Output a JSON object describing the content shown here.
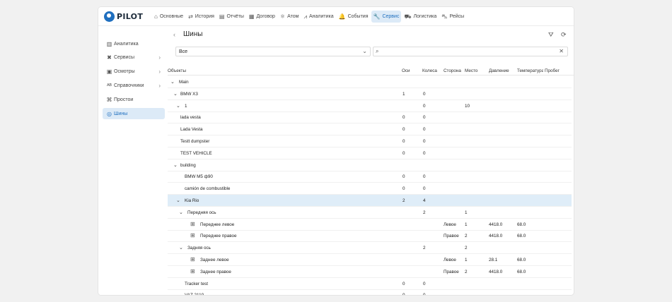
{
  "app": {
    "logo": "PILOT"
  },
  "nav": [
    {
      "icon": "home-icon",
      "glyph": "⌂",
      "label": "Основные"
    },
    {
      "icon": "arrows-icon",
      "glyph": "⇄",
      "label": "История"
    },
    {
      "icon": "report-icon",
      "glyph": "▤",
      "label": "Отчёты"
    },
    {
      "icon": "contract-icon",
      "glyph": "▦",
      "label": "Договор"
    },
    {
      "icon": "atom-icon",
      "glyph": "⚛",
      "label": "Атом"
    },
    {
      "icon": "analytics-icon",
      "glyph": "⩘",
      "label": "Аналитика"
    },
    {
      "icon": "bell-icon",
      "glyph": "🔔",
      "label": "События"
    },
    {
      "icon": "wrench-icon",
      "glyph": "🔧",
      "label": "Сервис"
    },
    {
      "icon": "truck-icon",
      "glyph": "⛟",
      "label": "Логистика"
    },
    {
      "icon": "bus-icon",
      "glyph": "⛍",
      "label": "Рейсы"
    }
  ],
  "nav_active": "Сервис",
  "sidebar": [
    {
      "icon": "bar-chart-icon",
      "glyph": "▥",
      "label": "Аналитика",
      "chevron": false
    },
    {
      "icon": "tools-icon",
      "glyph": "✖",
      "label": "Сервисы",
      "chevron": true
    },
    {
      "icon": "inspection-icon",
      "glyph": "▣",
      "label": "Осмотры",
      "chevron": true
    },
    {
      "icon": "abc-icon",
      "glyph": "ᴬᴮ",
      "label": "Справочники",
      "chevron": true
    },
    {
      "icon": "downtime-icon",
      "glyph": "⌘",
      "label": "Простои",
      "chevron": false
    },
    {
      "icon": "tire-icon",
      "glyph": "◎",
      "label": "Шины",
      "chevron": false
    }
  ],
  "sidebar_chevron": "›",
  "page": {
    "title": "Шины",
    "back": "‹"
  },
  "filter": {
    "value": "Все",
    "chevron": "⌄"
  },
  "search": {
    "placeholder": "",
    "clear": "✕",
    "icon_glyph": "⌕"
  },
  "header_icons": {
    "filter_glyph": "⛛",
    "refresh_glyph": "⟳"
  },
  "columns": {
    "objects": "Объекты",
    "axes": "Оси",
    "wheels": "Колеса",
    "side": "Сторона",
    "place": "Место",
    "pressure": "Давление",
    "temperature": "Температура",
    "mileage": "Пробег"
  },
  "glyphs": {
    "expand": "⌄",
    "tire": "⊞"
  },
  "rows": [
    {
      "level": 0,
      "toggle": true,
      "name": "Main",
      "axes": "",
      "wheels": "",
      "side": "",
      "place": "",
      "pressure": "",
      "temp": "",
      "selected": false,
      "tire": false
    },
    {
      "level": 1,
      "toggle": true,
      "name": "BMW X3",
      "axes": "1",
      "wheels": "0",
      "side": "",
      "place": "",
      "pressure": "",
      "temp": "",
      "selected": false,
      "tire": false
    },
    {
      "level": 2,
      "toggle": true,
      "name": "1",
      "axes": "",
      "wheels": "0",
      "side": "",
      "place": "10",
      "pressure": "",
      "temp": "",
      "selected": false,
      "tire": false
    },
    {
      "level": 1,
      "toggle": false,
      "name": "lada vesta",
      "axes": "0",
      "wheels": "0",
      "side": "",
      "place": "",
      "pressure": "",
      "temp": "",
      "selected": false,
      "tire": false
    },
    {
      "level": 1,
      "toggle": false,
      "name": "Lada Vesta",
      "axes": "0",
      "wheels": "0",
      "side": "",
      "place": "",
      "pressure": "",
      "temp": "",
      "selected": false,
      "tire": false
    },
    {
      "level": 1,
      "toggle": false,
      "name": "Testt dumpster",
      "axes": "0",
      "wheels": "0",
      "side": "",
      "place": "",
      "pressure": "",
      "temp": "",
      "selected": false,
      "tire": false
    },
    {
      "level": 1,
      "toggle": false,
      "name": "TEST VEHICLE",
      "axes": "0",
      "wheels": "0",
      "side": "",
      "place": "",
      "pressure": "",
      "temp": "",
      "selected": false,
      "tire": false
    },
    {
      "level": 1,
      "toggle": true,
      "name": "building",
      "axes": "",
      "wheels": "",
      "side": "",
      "place": "",
      "pressure": "",
      "temp": "",
      "selected": false,
      "tire": false
    },
    {
      "level": 2,
      "toggle": false,
      "name": "BMW M5 ф90",
      "axes": "0",
      "wheels": "0",
      "side": "",
      "place": "",
      "pressure": "",
      "temp": "",
      "selected": false,
      "tire": false
    },
    {
      "level": 2,
      "toggle": false,
      "name": "camión de combustible",
      "axes": "0",
      "wheels": "0",
      "side": "",
      "place": "",
      "pressure": "",
      "temp": "",
      "selected": false,
      "tire": false
    },
    {
      "level": 2,
      "toggle": true,
      "name": "Kia Rio",
      "axes": "2",
      "wheels": "4",
      "side": "",
      "place": "",
      "pressure": "",
      "temp": "",
      "selected": true,
      "tire": false
    },
    {
      "level": 3,
      "toggle": true,
      "name": "Передняя ось",
      "axes": "",
      "wheels": "2",
      "side": "",
      "place": "1",
      "pressure": "",
      "temp": "",
      "selected": false,
      "tire": false
    },
    {
      "level": 4,
      "toggle": false,
      "name": "Переднее левое",
      "axes": "",
      "wheels": "",
      "side": "Левое",
      "place": "1",
      "pressure": "4418.0",
      "temp": "68.0",
      "selected": false,
      "tire": true
    },
    {
      "level": 4,
      "toggle": false,
      "name": "Переднее правое",
      "axes": "",
      "wheels": "",
      "side": "Правое",
      "place": "2",
      "pressure": "4418.0",
      "temp": "68.0",
      "selected": false,
      "tire": true
    },
    {
      "level": 3,
      "toggle": true,
      "name": "Задняя ось",
      "axes": "",
      "wheels": "2",
      "side": "",
      "place": "2",
      "pressure": "",
      "temp": "",
      "selected": false,
      "tire": false
    },
    {
      "level": 4,
      "toggle": false,
      "name": "Заднее левое",
      "axes": "",
      "wheels": "",
      "side": "Левое",
      "place": "1",
      "pressure": "28.1",
      "temp": "68.0",
      "selected": false,
      "tire": true
    },
    {
      "level": 4,
      "toggle": false,
      "name": "Заднее правое",
      "axes": "",
      "wheels": "",
      "side": "Правое",
      "place": "2",
      "pressure": "4418.0",
      "temp": "68.0",
      "selected": false,
      "tire": true
    },
    {
      "level": 2,
      "toggle": false,
      "name": "Tracker test",
      "axes": "0",
      "wheels": "0",
      "side": "",
      "place": "",
      "pressure": "",
      "temp": "",
      "selected": false,
      "tire": false
    },
    {
      "level": 2,
      "toggle": false,
      "name": "VAZ 2110",
      "axes": "0",
      "wheels": "0",
      "side": "",
      "place": "",
      "pressure": "",
      "temp": "",
      "selected": false,
      "tire": false
    }
  ]
}
